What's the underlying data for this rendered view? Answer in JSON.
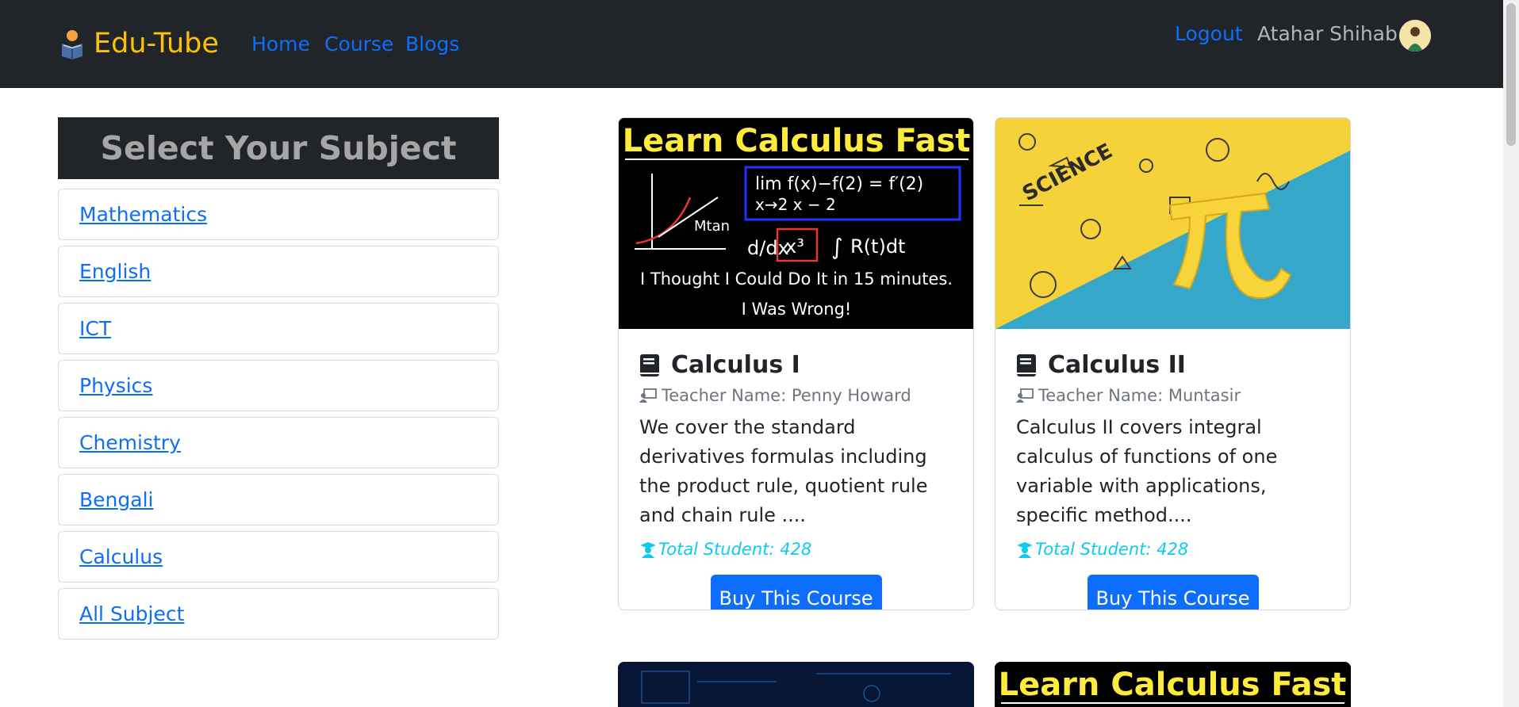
{
  "navbar": {
    "brand": "Edu-Tube",
    "links": [
      "Home",
      "Course",
      "Blogs"
    ],
    "logout": "Logout",
    "user_name": "Atahar Shihab"
  },
  "sidebar": {
    "title": "Select Your Subject",
    "subjects": [
      "Mathematics",
      "English",
      "ICT",
      "Physics",
      "Chemistry",
      "Bengali",
      "Calculus",
      "All Subject"
    ]
  },
  "courses": [
    {
      "thumb_title": "Learn Calculus Fast",
      "thumb_caption_1": "I Thought I Could Do It in 15 minutes.",
      "thumb_caption_2": "I Was Wrong!",
      "title": "Calculus I",
      "teacher": "Teacher Name: Penny Howard",
      "desc": "We cover the standard derivatives formulas including the product rule, quotient rule and chain rule ....",
      "students": "Total Student: 428",
      "button": "Buy This Course"
    },
    {
      "thumb_title": "SCIENCE",
      "title": "Calculus II",
      "teacher": "Teacher Name: Muntasir",
      "desc": "Calculus II covers integral calculus of functions of one variable with applications, specific method....",
      "students": "Total Student: 428",
      "button": "Buy This Course"
    }
  ],
  "bottom_cards": [
    {
      "thumb_title": ""
    },
    {
      "thumb_title": "Learn Calculus Fast"
    }
  ],
  "colors": {
    "navbar": "#212529",
    "brand": "#ffc107",
    "link": "#0d6efd",
    "info": "#0dcaf0"
  }
}
